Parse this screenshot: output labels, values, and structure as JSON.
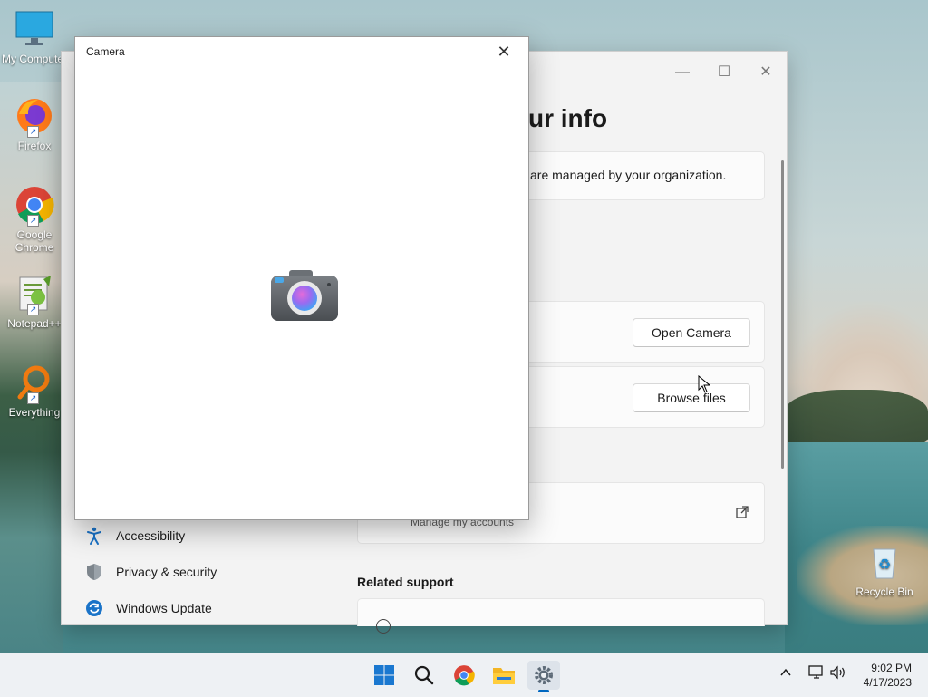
{
  "desktop": {
    "icons": [
      {
        "label": "My Computer",
        "icon": "monitor-icon"
      },
      {
        "label": "Firefox",
        "icon": "firefox-icon"
      },
      {
        "label": "Google Chrome",
        "icon": "chrome-icon"
      },
      {
        "label": "Notepad++",
        "icon": "notepadpp-icon"
      },
      {
        "label": "Everything",
        "icon": "search-ring-icon"
      },
      {
        "label": "Recycle Bin",
        "icon": "recycle-bin-icon"
      }
    ]
  },
  "settings": {
    "heading": "ur info",
    "org_notice": "are managed by your organization.",
    "open_camera_label": "Open Camera",
    "browse_files_label": "Browse files",
    "manage_accounts_label": "Manage my accounts",
    "related_support_label": "Related support",
    "nav": [
      {
        "label": "Accessibility",
        "icon": "accessibility-icon"
      },
      {
        "label": "Privacy & security",
        "icon": "shield-icon"
      },
      {
        "label": "Windows Update",
        "icon": "refresh-icon"
      }
    ]
  },
  "camera_window": {
    "title": "Camera",
    "close_symbol": "✕",
    "icon": "camera-icon"
  },
  "taskbar": {
    "apps": [
      "windows-start-icon",
      "search-icon",
      "chrome-icon",
      "file-explorer-icon",
      "settings-gear-icon"
    ],
    "time": "9:02 PM",
    "date": "4/17/2023"
  },
  "colors": {
    "accent": "#0067c0",
    "taskbar": "#eef1f4"
  }
}
